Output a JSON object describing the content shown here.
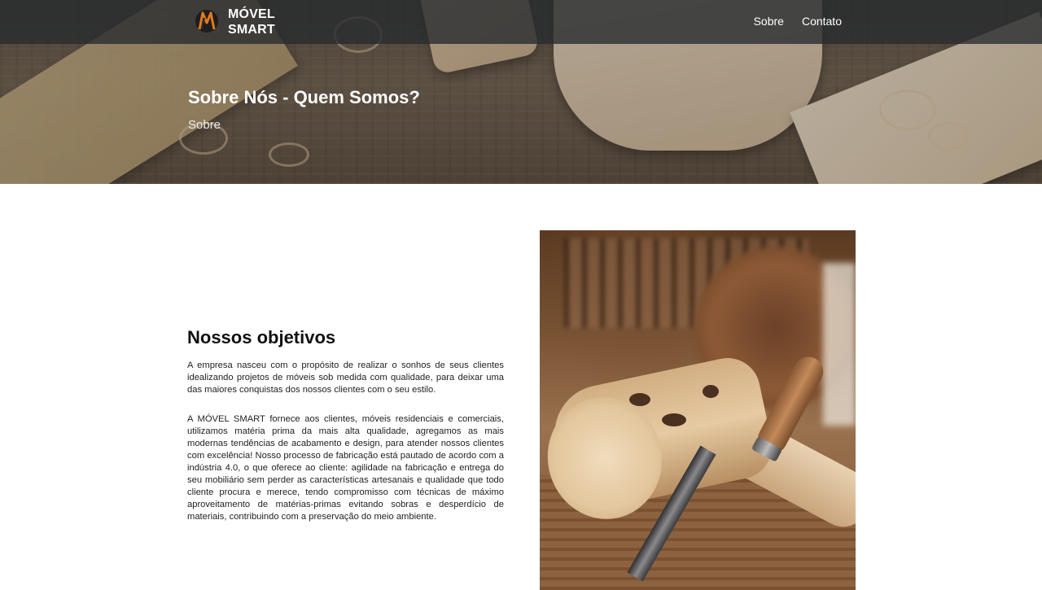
{
  "brand": {
    "name_line1": "MÓVEL",
    "name_line2": "SMART"
  },
  "nav": {
    "items": [
      {
        "label": "Sobre"
      },
      {
        "label": "Contato"
      }
    ]
  },
  "hero": {
    "title": "Sobre Nós - Quem Somos?",
    "breadcrumb": "Sobre"
  },
  "about": {
    "title": "Nossos objetivos",
    "paragraph1": "A empresa nasceu com o propósito de realizar o sonhos de seus clientes idealizando projetos de móveis sob medida com qualidade, para deixar uma das maiores conquistas dos nossos clientes com o seu estilo.",
    "paragraph2": "A MÓVEL SMART fornece aos clientes, móveis residenciais e comerciais, utilizamos matéria prima da mais alta qualidade, agregamos as mais modernas tendências de acabamento e design, para atender nossos clientes com excelência! Nosso processo de fabricação está pautado de acordo com a indústria 4.0, o que oferece ao cliente: agilidade na fabricação e entrega do seu mobiliário sem perder as características artesanais e qualidade que todo cliente procura e merece, tendo compromisso com técnicas de máximo aproveitamento de matérias-primas evitando sobras e desperdício de materiais, contribuindo com a preservação do meio ambiente."
  },
  "colors": {
    "navbar": "#262a2e",
    "logo_accent": "#e07a1f",
    "text_dark": "#111111"
  },
  "icons": {
    "logo": "movel-smart-logo-icon"
  }
}
